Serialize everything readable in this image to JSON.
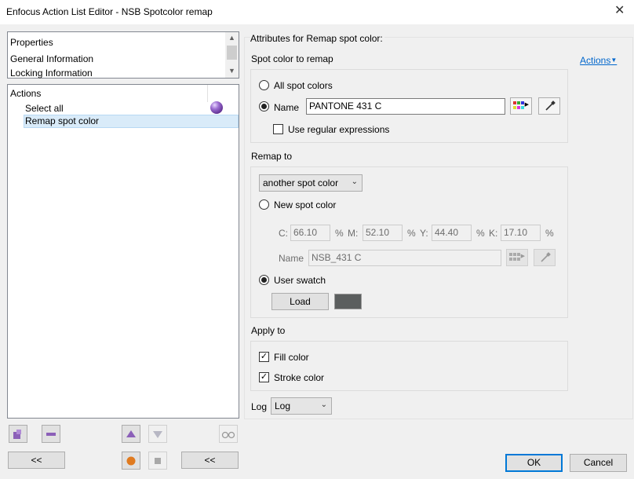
{
  "window": {
    "title": "Enfocus Action List Editor - NSB Spotcolor remap",
    "close_glyph": "✕"
  },
  "left": {
    "properties_list": {
      "heading": "Properties",
      "items": [
        "General Information",
        "Locking Information"
      ]
    },
    "actions_tree": {
      "heading": "Actions",
      "items": [
        {
          "label": "Select all"
        },
        {
          "label": "Remap spot color",
          "selected": true
        }
      ]
    },
    "buttons": {
      "collapse_left": "<<",
      "collapse_right": "<<"
    }
  },
  "right": {
    "attributes_title": "Attributes for Remap spot color:",
    "actions_link": "Actions",
    "spot_color_group": {
      "label": "Spot color to remap",
      "all_spot_colors": "All spot colors",
      "name_option": "Name",
      "name_value": "PANTONE 431 C",
      "use_regex": "Use regular expressions"
    },
    "remap_group": {
      "label": "Remap to",
      "mode_select": "another spot color",
      "new_spot_color": "New spot color",
      "cmyk": {
        "c_label": "C:",
        "c_value": "66.10",
        "m_label": "M:",
        "m_value": "52.10",
        "y_label": "Y:",
        "y_value": "44.40",
        "k_label": "K:",
        "k_value": "17.10",
        "percent": "%"
      },
      "name_label": "Name",
      "name_value": "NSB_431 C",
      "user_swatch": "User swatch",
      "load_button": "Load",
      "swatch_color": "#5b5e5e"
    },
    "apply_group": {
      "label": "Apply to",
      "fill_color": "Fill color",
      "stroke_color": "Stroke color"
    },
    "log": {
      "label": "Log",
      "value": "Log"
    }
  },
  "footer": {
    "ok": "OK",
    "cancel": "Cancel"
  },
  "colors": {
    "accent": "#0078d7",
    "selection": "#d9ebf9",
    "icon_purple": "#8b5fb8",
    "icon_orange": "#e07a1f"
  }
}
